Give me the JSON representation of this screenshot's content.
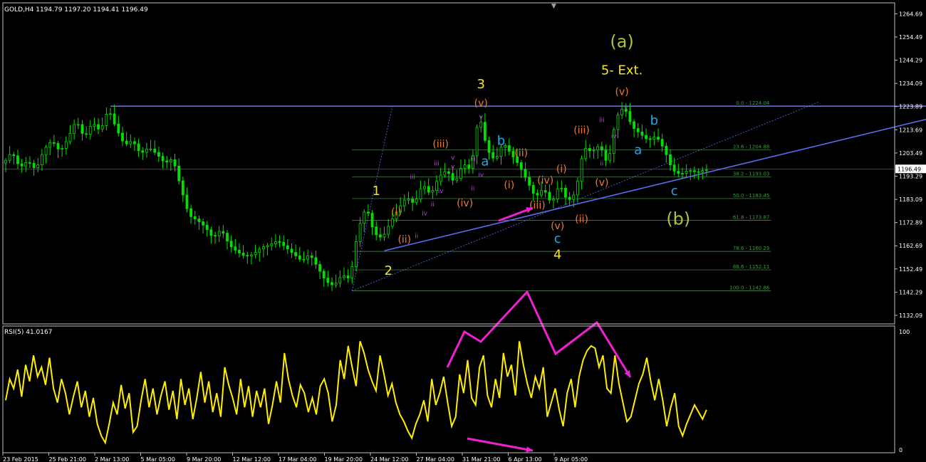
{
  "main_header": "GOLD,H4  1194.79 1197.20 1194.41 1196.49",
  "rsi_header": "RSI(5) 41.0167",
  "current_price_label": "1196.49",
  "colors": {
    "background": "#000000",
    "frame": "#c0c0c0",
    "candle": "#00e000",
    "rsi_line": "#ffee00",
    "trendline": "#5b6cf0",
    "fib": "#4e9a4e",
    "fib_text": "#3e9a3e",
    "wave_primary": "#f5e32b",
    "wave_minor": "#ee7b2d",
    "wave_sub": "#b04bd0",
    "wave_abc": "#1fa9ee",
    "wave_major": "#a8c43a",
    "arrow": "#f020d0"
  },
  "chart_data": [
    {
      "type": "candlestick",
      "title": "GOLD,H4",
      "ohlc_last": {
        "open": 1194.79,
        "high": 1197.2,
        "low": 1194.41,
        "close": 1196.49
      },
      "ylim": [
        1132.09,
        1269.5
      ],
      "y_ticks": [
        "1264.69",
        "1254.49",
        "1244.29",
        "1234.09",
        "1223.89",
        "1213.69",
        "1203.49",
        "1193.29",
        "1183.09",
        "1172.89",
        "1162.69",
        "1152.49",
        "1142.29",
        "1132.09"
      ],
      "x_ticks": [
        "23 Feb 2015",
        "25 Feb 21:00",
        "2 Mar 13:00",
        "5 Mar 05:00",
        "9 Mar 20:00",
        "12 Mar 12:00",
        "17 Mar 04:00",
        "19 Mar 20:00",
        "24 Mar 12:00",
        "27 Mar 04:00",
        "31 Mar 21:00",
        "6 Apr 13:00",
        "9 Apr 05:00"
      ],
      "price_path": [
        [
          0,
          1199
        ],
        [
          2,
          1204
        ],
        [
          4,
          1197
        ],
        [
          6,
          1200
        ],
        [
          8,
          1196
        ],
        [
          10,
          1205
        ],
        [
          12,
          1209
        ],
        [
          14,
          1204
        ],
        [
          16,
          1210
        ],
        [
          18,
          1218
        ],
        [
          20,
          1210
        ],
        [
          22,
          1217
        ],
        [
          24,
          1213
        ],
        [
          26,
          1223
        ],
        [
          28,
          1214
        ],
        [
          30,
          1207
        ],
        [
          32,
          1209
        ],
        [
          34,
          1203
        ],
        [
          36,
          1206
        ],
        [
          38,
          1203
        ],
        [
          40,
          1199
        ],
        [
          42,
          1201
        ],
        [
          44,
          1188
        ],
        [
          46,
          1176
        ],
        [
          48,
          1174
        ],
        [
          50,
          1171
        ],
        [
          52,
          1166
        ],
        [
          54,
          1170
        ],
        [
          56,
          1163
        ],
        [
          58,
          1160
        ],
        [
          60,
          1158
        ],
        [
          62,
          1159
        ],
        [
          64,
          1162
        ],
        [
          66,
          1163
        ],
        [
          68,
          1165
        ],
        [
          70,
          1162
        ],
        [
          72,
          1159
        ],
        [
          74,
          1156
        ],
        [
          76,
          1159
        ],
        [
          78,
          1153
        ],
        [
          80,
          1147
        ],
        [
          82,
          1145
        ],
        [
          84,
          1150
        ],
        [
          86,
          1148
        ],
        [
          88,
          1170
        ],
        [
          90,
          1180
        ],
        [
          92,
          1168
        ],
        [
          94,
          1166
        ],
        [
          96,
          1173
        ],
        [
          98,
          1179
        ],
        [
          100,
          1184
        ],
        [
          102,
          1181
        ],
        [
          104,
          1190
        ],
        [
          106,
          1185
        ],
        [
          108,
          1193
        ],
        [
          110,
          1196
        ],
        [
          112,
          1190
        ],
        [
          114,
          1199
        ],
        [
          116,
          1196
        ],
        [
          118,
          1221
        ],
        [
          120,
          1205
        ],
        [
          122,
          1200
        ],
        [
          124,
          1208
        ],
        [
          126,
          1203
        ],
        [
          128,
          1198
        ],
        [
          130,
          1191
        ],
        [
          132,
          1184
        ],
        [
          134,
          1188
        ],
        [
          136,
          1181
        ],
        [
          138,
          1190
        ],
        [
          140,
          1182
        ],
        [
          142,
          1186
        ],
        [
          144,
          1206
        ],
        [
          146,
          1204
        ],
        [
          148,
          1207
        ],
        [
          150,
          1198
        ],
        [
          152,
          1219
        ],
        [
          154,
          1224
        ],
        [
          156,
          1215
        ],
        [
          158,
          1212
        ],
        [
          160,
          1209
        ],
        [
          162,
          1211
        ],
        [
          164,
          1205
        ],
        [
          166,
          1196
        ],
        [
          168,
          1194
        ],
        [
          170,
          1196
        ],
        [
          172,
          1195
        ],
        [
          174,
          1196
        ]
      ],
      "fib_levels": [
        {
          "price": 1224.04,
          "label": "0.0 - 1224.04"
        },
        {
          "price": 1204.88,
          "label": "23.6 - 1204.88"
        },
        {
          "price": 1193.03,
          "label": "38.2 - 1193.03"
        },
        {
          "price": 1183.45,
          "label": "50.0 - 1183.45"
        },
        {
          "price": 1173.87,
          "label": "61.8 - 1173.87"
        },
        {
          "price": 1160.23,
          "label": "78.6 - 1160.23"
        },
        {
          "price": 1152.11,
          "label": "88.6 - 1152.11"
        },
        {
          "price": 1142.86,
          "label": "100.0 - 1142.86"
        }
      ],
      "wave_labels": [
        {
          "text": "(a)",
          "color": "major",
          "size": "xl",
          "x": 153,
          "price": 1250
        },
        {
          "text": "5- Ext.",
          "color": "primary",
          "size": "lg",
          "x": 153,
          "price": 1238
        },
        {
          "text": "(v)",
          "color": "minor",
          "size": "md",
          "x": 153,
          "price": 1229
        },
        {
          "text": "v",
          "color": "sub",
          "size": "sm",
          "x": 154,
          "price": 1222.5
        },
        {
          "text": "iii",
          "color": "sub",
          "size": "sm",
          "x": 148,
          "price": 1217
        },
        {
          "text": "iv",
          "color": "sub",
          "size": "sm",
          "x": 151,
          "price": 1210
        },
        {
          "text": "b",
          "color": "abc",
          "size": "lg",
          "x": 161,
          "price": 1216
        },
        {
          "text": "a",
          "color": "abc",
          "size": "lg",
          "x": 157,
          "price": 1203
        },
        {
          "text": "3",
          "color": "primary",
          "size": "lg",
          "x": 118,
          "price": 1232
        },
        {
          "text": "(v)",
          "color": "minor",
          "size": "md",
          "x": 118,
          "price": 1224
        },
        {
          "text": "v",
          "color": "sub",
          "size": "sm",
          "x": 118,
          "price": 1218.5
        },
        {
          "text": "b",
          "color": "abc",
          "size": "lg",
          "x": 123,
          "price": 1207
        },
        {
          "text": "a",
          "color": "abc",
          "size": "lg",
          "x": 119,
          "price": 1198
        },
        {
          "text": "(iii)",
          "color": "minor",
          "size": "md",
          "x": 108,
          "price": 1206
        },
        {
          "text": "(ii)",
          "color": "minor",
          "size": "md",
          "x": 128,
          "price": 1202
        },
        {
          "text": "(iii)",
          "color": "minor",
          "size": "md",
          "x": 143,
          "price": 1212
        },
        {
          "text": "i",
          "color": "sub",
          "size": "sm",
          "x": 148,
          "price": 1204
        },
        {
          "text": "ii",
          "color": "sub",
          "size": "sm",
          "x": 148,
          "price": 1198
        },
        {
          "text": "(i)",
          "color": "minor",
          "size": "md",
          "x": 138,
          "price": 1195
        },
        {
          "text": "(v)",
          "color": "minor",
          "size": "md",
          "x": 148,
          "price": 1189
        },
        {
          "text": "(i)",
          "color": "minor",
          "size": "md",
          "x": 125,
          "price": 1188
        },
        {
          "text": "(iv)",
          "color": "minor",
          "size": "md",
          "x": 134,
          "price": 1190
        },
        {
          "text": "(iv)",
          "color": "minor",
          "size": "md",
          "x": 114,
          "price": 1180
        },
        {
          "text": "(iii)",
          "color": "minor",
          "size": "md",
          "x": 132,
          "price": 1179
        },
        {
          "text": "(v)",
          "color": "minor",
          "size": "md",
          "x": 137,
          "price": 1170
        },
        {
          "text": "(ii)",
          "color": "minor",
          "size": "md",
          "x": 143,
          "price": 1173
        },
        {
          "text": "c",
          "color": "abc",
          "size": "lg",
          "x": 137,
          "price": 1164
        },
        {
          "text": "4",
          "color": "primary",
          "size": "lg",
          "x": 137,
          "price": 1157
        },
        {
          "text": "1",
          "color": "primary",
          "size": "lg",
          "x": 92,
          "price": 1185
        },
        {
          "text": "(i)",
          "color": "minor",
          "size": "md",
          "x": 97,
          "price": 1176
        },
        {
          "text": "(ii)",
          "color": "minor",
          "size": "md",
          "x": 99,
          "price": 1164
        },
        {
          "text": "ii",
          "color": "sub",
          "size": "sm",
          "x": 102,
          "price": 1166
        },
        {
          "text": "iii",
          "color": "sub",
          "size": "sm",
          "x": 101,
          "price": 1192
        },
        {
          "text": "iv",
          "color": "sub",
          "size": "sm",
          "x": 104,
          "price": 1176
        },
        {
          "text": "ii",
          "color": "sub",
          "size": "sm",
          "x": 106,
          "price": 1180
        },
        {
          "text": "iii",
          "color": "sub",
          "size": "sm",
          "x": 107,
          "price": 1198
        },
        {
          "text": "iv",
          "color": "sub",
          "size": "sm",
          "x": 108,
          "price": 1186
        },
        {
          "text": "v",
          "color": "sub",
          "size": "sm",
          "x": 111,
          "price": 1200.5
        },
        {
          "text": "v",
          "color": "sub",
          "size": "sm",
          "x": 111,
          "price": 1196.5
        },
        {
          "text": "iii",
          "color": "sub",
          "size": "sm",
          "x": 116,
          "price": 1200
        },
        {
          "text": "iv",
          "color": "sub",
          "size": "sm",
          "x": 118,
          "price": 1193
        },
        {
          "text": "ii",
          "color": "sub",
          "size": "sm",
          "x": 116,
          "price": 1187
        },
        {
          "text": "2",
          "color": "primary",
          "size": "lg",
          "x": 95,
          "price": 1150
        },
        {
          "text": "c",
          "color": "abc",
          "size": "lg",
          "x": 166,
          "price": 1185
        },
        {
          "text": "(b)",
          "color": "major",
          "size": "xl",
          "x": 167,
          "price": 1172
        }
      ]
    },
    {
      "type": "line",
      "title": "RSI(5) 41.0167",
      "ylim": [
        0,
        100
      ],
      "y_ticks": [
        "100",
        "0"
      ],
      "values": [
        42,
        60,
        52,
        68,
        45,
        72,
        58,
        80,
        62,
        70,
        55,
        78,
        52,
        40,
        60,
        48,
        30,
        45,
        58,
        36,
        50,
        28,
        44,
        22,
        12,
        6,
        22,
        40,
        30,
        55,
        35,
        48,
        15,
        20,
        42,
        60,
        36,
        52,
        30,
        46,
        58,
        34,
        50,
        26,
        60,
        38,
        52,
        26,
        44,
        66,
        40,
        58,
        32,
        48,
        28,
        70,
        55,
        44,
        30,
        60,
        36,
        54,
        28,
        50,
        36,
        52,
        22,
        38,
        58,
        40,
        82,
        60,
        46,
        36,
        55,
        48,
        32,
        44,
        30,
        54,
        60,
        48,
        24,
        38,
        76,
        60,
        88,
        70,
        54,
        92,
        82,
        68,
        58,
        50,
        80,
        64,
        46,
        56,
        40,
        30,
        24,
        16,
        10,
        22,
        30,
        42,
        24,
        60,
        38,
        48,
        62,
        40,
        20,
        28,
        64,
        48,
        76,
        44,
        38,
        70,
        80,
        46,
        36,
        60,
        44,
        82,
        62,
        72,
        46,
        92,
        72,
        56,
        44,
        62,
        52,
        70,
        28,
        40,
        52,
        34,
        20,
        48,
        60,
        36,
        62,
        76,
        84,
        88,
        86,
        70,
        80,
        52,
        48,
        80,
        56,
        40,
        24,
        28,
        42,
        56,
        64,
        78,
        58,
        42,
        60,
        42,
        20,
        36,
        48,
        20,
        12,
        22,
        30,
        38,
        32,
        26,
        34
      ]
    }
  ]
}
